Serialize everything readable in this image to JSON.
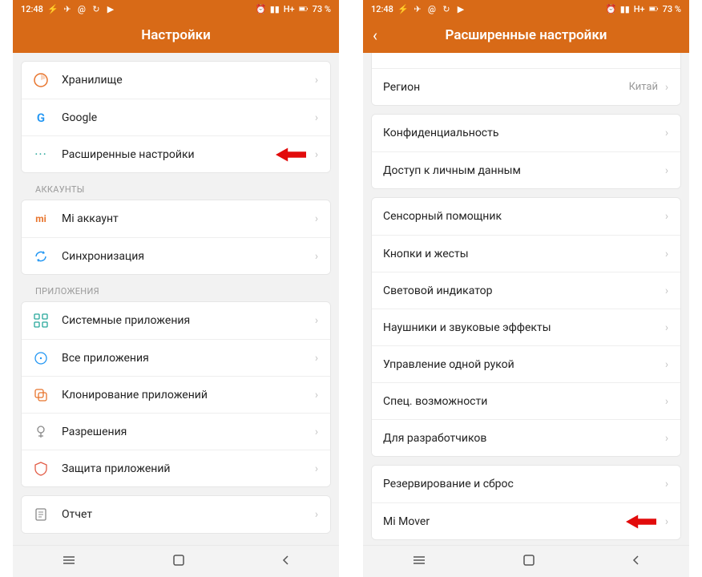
{
  "status": {
    "time": "12:48",
    "network": "H+",
    "battery_pct": "73 %",
    "icons_left": [
      "bolt-icon",
      "telegram-icon",
      "at-icon",
      "refresh-icon",
      "play-icon"
    ],
    "icons_right": [
      "alarm-icon",
      "signal-icon"
    ]
  },
  "left_screen": {
    "title": "Настройки",
    "groups": [
      {
        "rows": [
          {
            "icon": "storage-icon",
            "label": "Хранилище"
          },
          {
            "icon": "google-icon",
            "label": "Google"
          },
          {
            "icon": "more-icon",
            "label": "Расширенные настройки",
            "arrow": true
          }
        ]
      },
      {
        "header": "АККАУНТЫ",
        "rows": [
          {
            "icon": "mi-icon",
            "label": "Mi аккаунт"
          },
          {
            "icon": "sync-icon",
            "label": "Синхронизация"
          }
        ]
      },
      {
        "header": "ПРИЛОЖЕНИЯ",
        "rows": [
          {
            "icon": "apps-icon",
            "label": "Системные приложения"
          },
          {
            "icon": "all-apps-icon",
            "label": "Все приложения"
          },
          {
            "icon": "clone-icon",
            "label": "Клонирование приложений"
          },
          {
            "icon": "permissions-icon",
            "label": "Разрешения"
          },
          {
            "icon": "shield-icon",
            "label": "Защита приложений"
          }
        ]
      },
      {
        "rows": [
          {
            "icon": "report-icon",
            "label": "Отчет"
          }
        ]
      }
    ]
  },
  "right_screen": {
    "title": "Расширенные настройки",
    "groups": [
      {
        "rows": [
          {
            "label": "Регион",
            "value": "Китай"
          }
        ]
      },
      {
        "rows": [
          {
            "label": "Конфиденциальность"
          },
          {
            "label": "Доступ к личным данным"
          }
        ]
      },
      {
        "rows": [
          {
            "label": "Сенсорный помощник"
          },
          {
            "label": "Кнопки и жесты"
          },
          {
            "label": "Световой индикатор"
          },
          {
            "label": "Наушники и звуковые эффекты"
          },
          {
            "label": "Управление одной рукой"
          },
          {
            "label": "Спец. возможности"
          },
          {
            "label": "Для разработчиков"
          }
        ]
      },
      {
        "rows": [
          {
            "label": "Резервирование и сброс"
          },
          {
            "label": "Mi Mover",
            "arrow": true
          }
        ]
      }
    ]
  },
  "navbar": {
    "recent": "≡",
    "home": "▢",
    "back": "‹"
  }
}
